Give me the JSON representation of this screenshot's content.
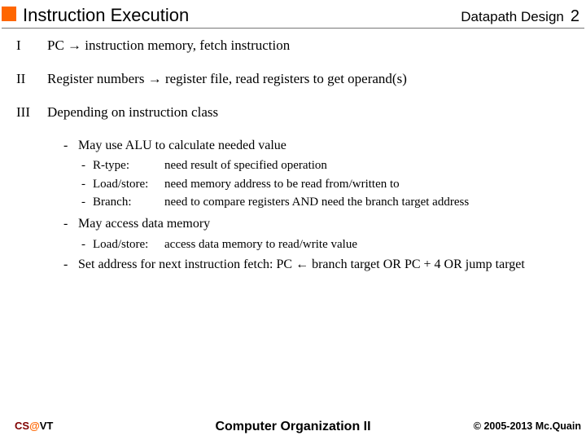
{
  "header": {
    "title": "Instruction Execution",
    "subtitle": "Datapath Design",
    "page": "2"
  },
  "steps": [
    {
      "num": "I",
      "text": "PC → instruction memory, fetch instruction"
    },
    {
      "num": "II",
      "text": "Register numbers → register file, read registers to get operand(s)"
    },
    {
      "num": "III",
      "text": "Depending on instruction class"
    }
  ],
  "sub": {
    "a": "May use ALU to calculate needed value",
    "a_items": [
      {
        "k": "R-type:",
        "v": "need result of specified operation"
      },
      {
        "k": "Load/store:",
        "v": "need memory address to be read from/written to"
      },
      {
        "k": "Branch:",
        "v": "need to compare registers AND need the branch target address"
      }
    ],
    "b": "May access data memory",
    "b_items": [
      {
        "k": "Load/store:",
        "v": "access data memory to read/write value"
      }
    ],
    "c": "Set address for next instruction fetch:  PC ← branch target OR PC + 4 OR jump target"
  },
  "footer": {
    "left_cs": "CS",
    "left_at": "@",
    "left_vt": "VT",
    "center": "Computer Organization II",
    "right": "© 2005-2013 Mc.Quain"
  }
}
